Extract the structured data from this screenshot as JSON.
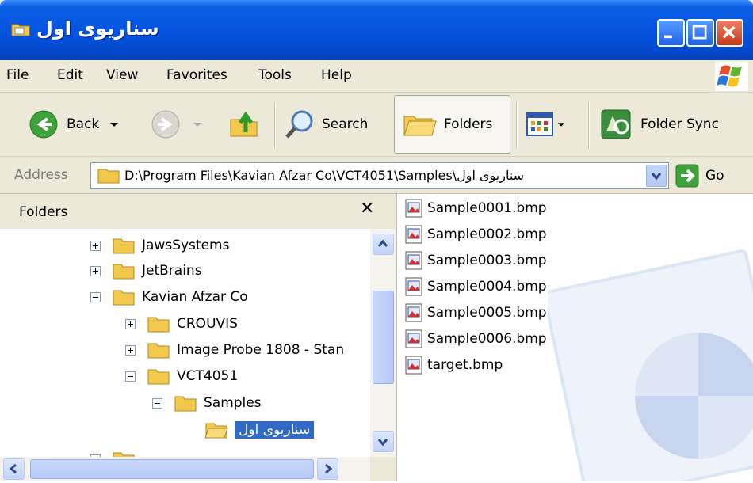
{
  "window": {
    "title": "سناریوی اول",
    "controls": [
      "minimize",
      "maximize",
      "close"
    ]
  },
  "menubar": {
    "items": [
      "File",
      "Edit",
      "View",
      "Favorites",
      "Tools",
      "Help"
    ]
  },
  "toolbar": {
    "back": "Back",
    "search": "Search",
    "folders": "Folders",
    "folder_sync": "Folder Sync"
  },
  "address": {
    "label": "Address",
    "path": "D:\\Program Files\\Kavian Afzar Co\\VCT4051\\Samples\\سناریوی اول",
    "go": "Go"
  },
  "folder_pane": {
    "title": "Folders",
    "tree": [
      {
        "label": "JawsSystems",
        "state": "collapsed"
      },
      {
        "label": "JetBrains",
        "state": "collapsed"
      },
      {
        "label": "Kavian Afzar Co",
        "state": "expanded"
      },
      {
        "label": "CROUVIS",
        "state": "collapsed"
      },
      {
        "label": "Image Probe 1808 - Stan",
        "state": "collapsed"
      },
      {
        "label": "VCT4051",
        "state": "expanded"
      },
      {
        "label": "Samples",
        "state": "expanded"
      },
      {
        "label": "سناریوی اول",
        "state": "selected"
      }
    ]
  },
  "files": [
    "Sample0001.bmp",
    "Sample0002.bmp",
    "Sample0003.bmp",
    "Sample0004.bmp",
    "Sample0005.bmp",
    "Sample0006.bmp",
    "target.bmp"
  ],
  "colors": {
    "titlebar": "#0553e0",
    "selection": "#316ac5",
    "chrome": "#ece9d8"
  }
}
